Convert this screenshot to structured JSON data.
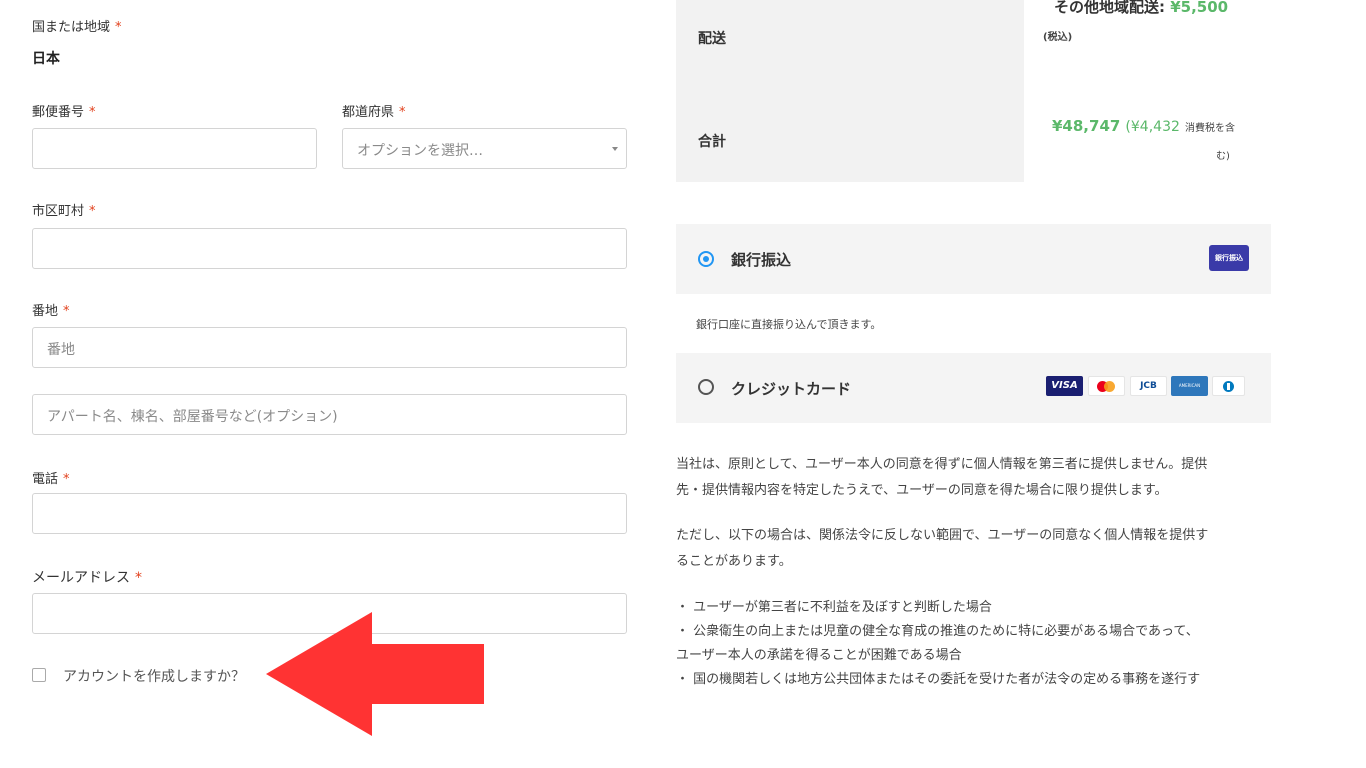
{
  "form": {
    "country": {
      "label": "国または地域",
      "required": "*",
      "value": "日本"
    },
    "postal": {
      "label": "郵便番号",
      "required": "*",
      "value": ""
    },
    "prefecture": {
      "label": "都道府県",
      "required": "*",
      "placeholder": "オプションを選択…"
    },
    "city": {
      "label": "市区町村",
      "required": "*",
      "value": ""
    },
    "address1": {
      "label": "番地",
      "required": "*",
      "placeholder": "番地"
    },
    "address2": {
      "placeholder": "アパート名、棟名、部屋番号など(オプション)"
    },
    "phone": {
      "label": "電話",
      "required": "*",
      "value": ""
    },
    "email": {
      "label": "メールアドレス",
      "required": "*",
      "value": ""
    },
    "create_account": {
      "label": "アカウントを作成しますか？",
      "checked": false
    }
  },
  "summary": {
    "shipping": {
      "label": "配送",
      "other_region_label": "その他地域配送:",
      "other_region_price": "¥5,500",
      "tax_note": "(税込)"
    },
    "total": {
      "label": "合計",
      "amount": "¥48,747",
      "tax_open": "(",
      "tax_amount": "¥4,432",
      "tax_label": "消費税を含",
      "tax_label_cont": "む)"
    }
  },
  "payment": {
    "bank": {
      "label": "銀行振込",
      "selected": true,
      "badge": "銀行振込",
      "description": "銀行口座に直接振り込んで頂きます。"
    },
    "card": {
      "label": "クレジットカード",
      "selected": false,
      "brands": [
        "VISA",
        "Mastercard",
        "JCB",
        "AMERICAN EXPRESS",
        "Diners Club"
      ],
      "visa_text": "VISA",
      "jcb_text": "JCB",
      "amex_text": "AMERICAN EXPRESS"
    }
  },
  "privacy": {
    "p1_line1": "当社は、原則として、ユーザー本人の同意を得ずに個人情報を第三者に提供しません。提供",
    "p1_line2": "先・提供情報内容を特定したうえで、ユーザーの同意を得た場合に限り提供します。",
    "p2_line1": "ただし、以下の場合は、関係法令に反しない範囲で、ユーザーの同意なく個人情報を提供す",
    "p2_line2": "ることがあります。",
    "item1": "・ ユーザーが第三者に不利益を及ぼすと判断した場合",
    "item2_line1": "・ 公衆衛生の向上または児童の健全な育成の推進のために特に必要がある場合であって、",
    "item2_line2": "ユーザー本人の承諾を得ることが困難である場合",
    "item3_line1": "・ 国の機関若しくは地方公共団体またはその委託を受けた者が法令の定める事務を遂行す"
  },
  "colors": {
    "accent_green": "#5bb86a",
    "required_red": "#e2401c",
    "annotation_arrow": "#ff3333",
    "radio_blue": "#2196f3"
  }
}
